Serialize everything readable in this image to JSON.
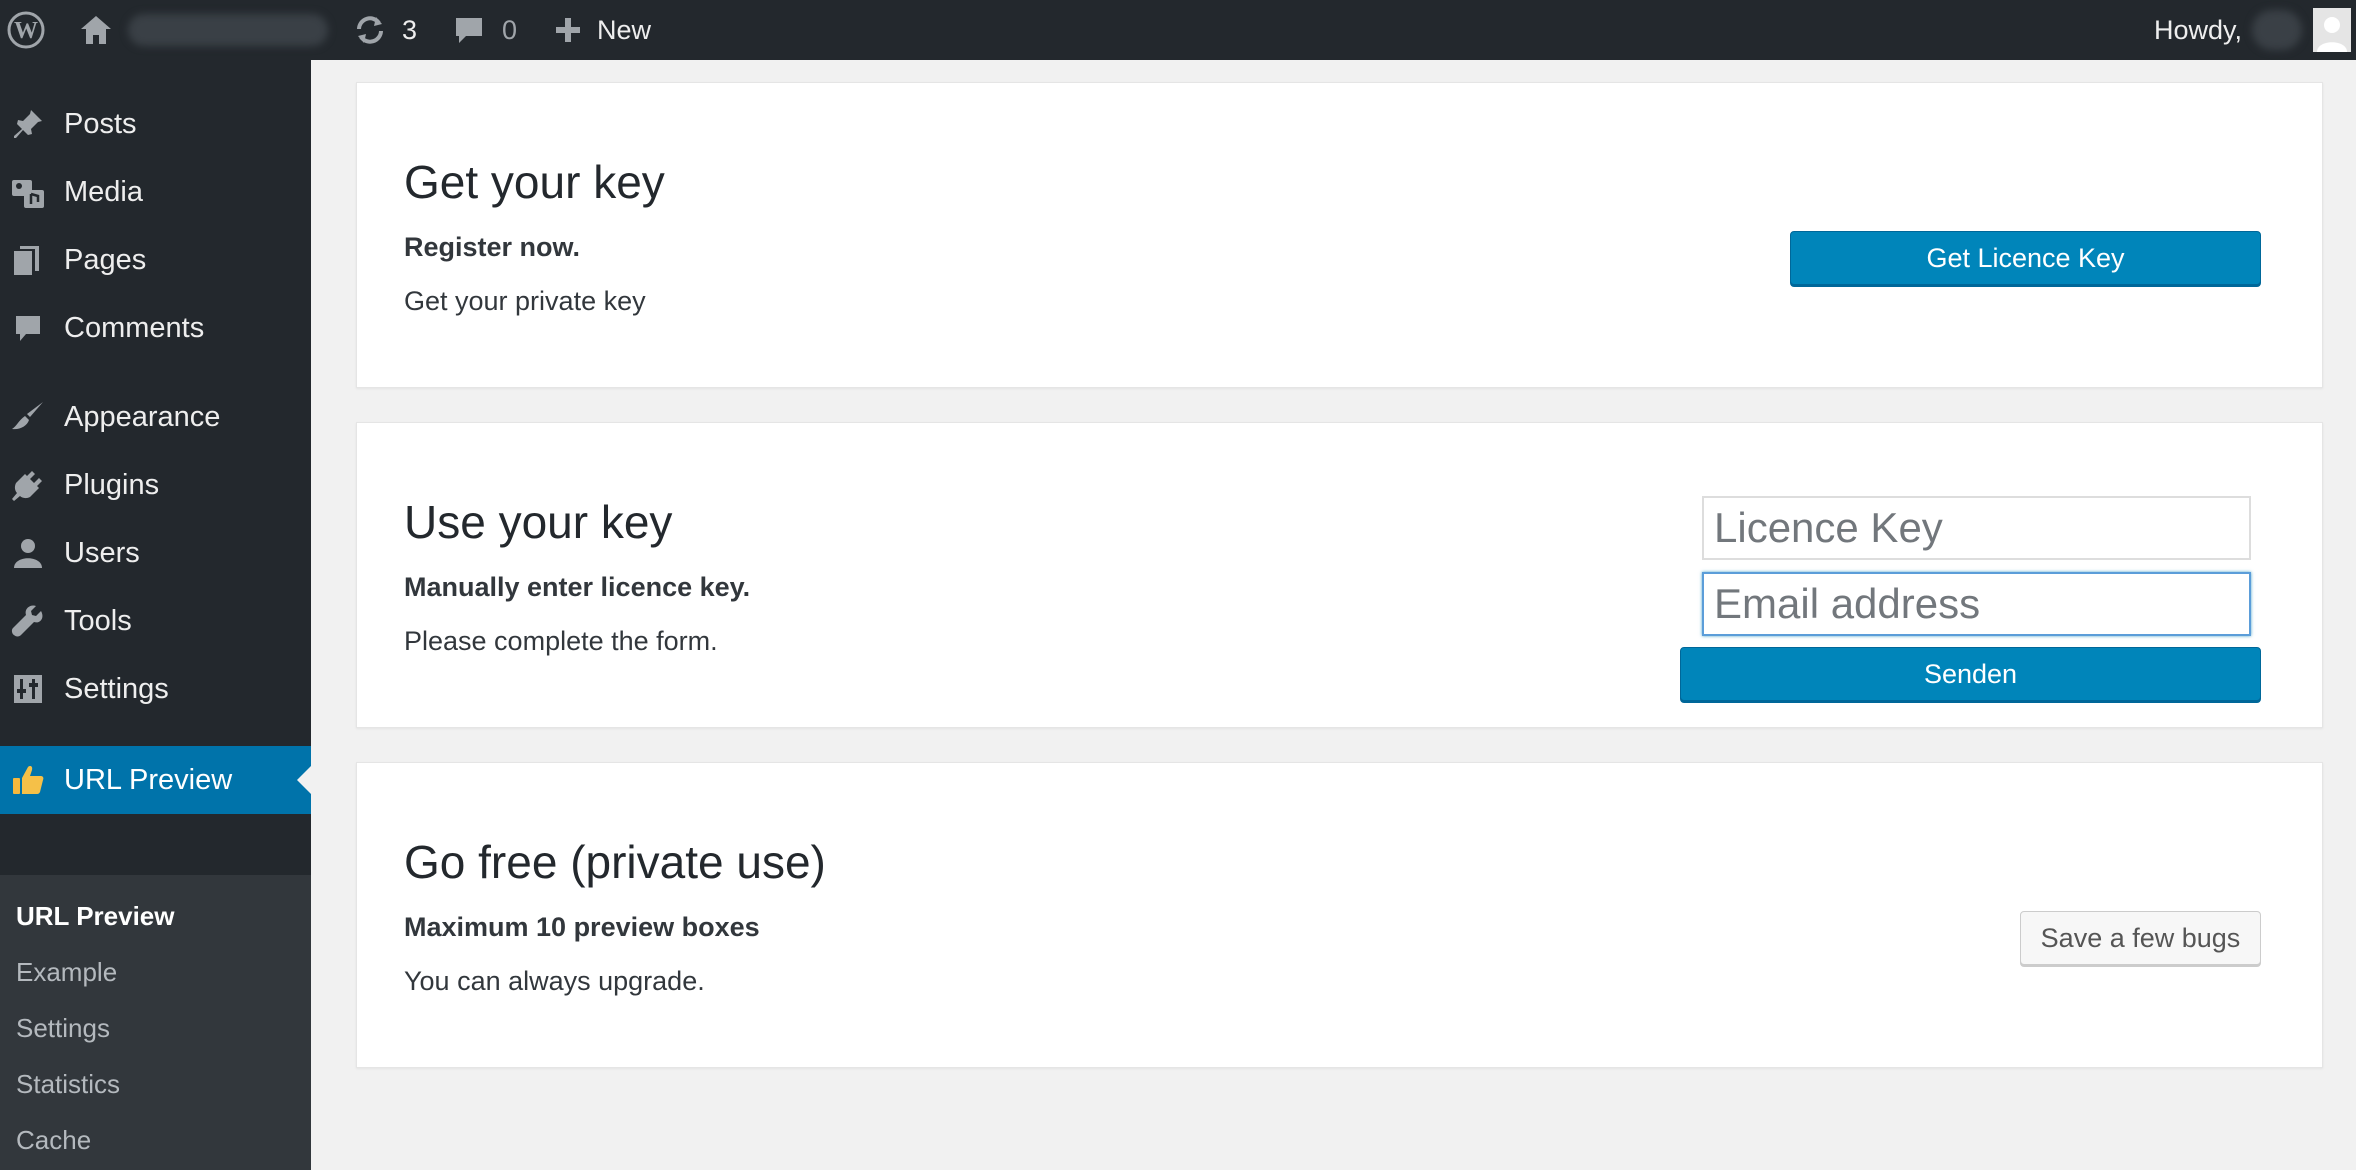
{
  "adminbar": {
    "updates_count": "3",
    "comments_count": "0",
    "new_label": "New",
    "howdy_label": "Howdy,"
  },
  "sidebar": {
    "items": [
      {
        "label": "Posts",
        "icon": "pin-icon"
      },
      {
        "label": "Media",
        "icon": "media-icon"
      },
      {
        "label": "Pages",
        "icon": "pages-icon"
      },
      {
        "label": "Comments",
        "icon": "comment-icon"
      },
      {
        "label": "Appearance",
        "icon": "paintbrush-icon"
      },
      {
        "label": "Plugins",
        "icon": "plug-icon"
      },
      {
        "label": "Users",
        "icon": "user-icon"
      },
      {
        "label": "Tools",
        "icon": "wrench-icon"
      },
      {
        "label": "Settings",
        "icon": "sliders-icon"
      },
      {
        "label": "URL Preview",
        "icon": "thumbs-up-icon",
        "current": true
      }
    ],
    "submenu": [
      "URL Preview",
      "Example",
      "Settings",
      "Statistics",
      "Cache"
    ]
  },
  "panels": {
    "get_key": {
      "title": "Get your key",
      "subtitle": "Register now.",
      "description": "Get your private key",
      "button_label": "Get Licence Key"
    },
    "use_key": {
      "title": "Use your key",
      "subtitle": "Manually enter licence key.",
      "description": "Please complete the form.",
      "licence_placeholder": "Licence Key",
      "email_placeholder": "Email address",
      "button_label": "Senden"
    },
    "go_free": {
      "title": "Go free (private use)",
      "subtitle": "Maximum 10 preview boxes",
      "description": "You can always upgrade.",
      "button_label": "Save a few bugs"
    }
  },
  "colors": {
    "adminbar_bg": "#23282d",
    "submenu_bg": "#32373c",
    "accent": "#0073aa",
    "primary_button": "#0085ba",
    "page_bg": "#f1f1f1"
  }
}
